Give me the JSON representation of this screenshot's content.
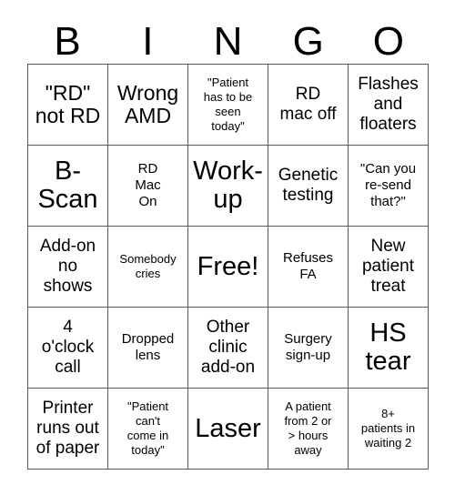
{
  "card": {
    "header_letters": [
      "B",
      "I",
      "N",
      "G",
      "O"
    ],
    "rows": [
      [
        {
          "text": "\"RD\"\nnot RD",
          "size": "lg"
        },
        {
          "text": "Wrong\nAMD",
          "size": "lg"
        },
        {
          "text": "\"Patient\nhas to be\nseen\ntoday\"",
          "size": "xs"
        },
        {
          "text": "RD\nmac off",
          "size": "md"
        },
        {
          "text": "Flashes\nand\nfloaters",
          "size": "md"
        }
      ],
      [
        {
          "text": "B-\nScan",
          "size": "xl"
        },
        {
          "text": "RD\nMac\nOn",
          "size": "sm"
        },
        {
          "text": "Work-\nup",
          "size": "xl"
        },
        {
          "text": "Genetic\ntesting",
          "size": "md"
        },
        {
          "text": "\"Can you\nre-send\nthat?\"",
          "size": "sm"
        }
      ],
      [
        {
          "text": "Add-on\nno\nshows",
          "size": "md"
        },
        {
          "text": "Somebody\ncries",
          "size": "xs"
        },
        {
          "text": "Free!",
          "size": "xl"
        },
        {
          "text": "Refuses\nFA",
          "size": "sm"
        },
        {
          "text": "New\npatient\ntreat",
          "size": "md"
        }
      ],
      [
        {
          "text": "4\no'clock\ncall",
          "size": "md"
        },
        {
          "text": "Dropped\nlens",
          "size": "sm"
        },
        {
          "text": "Other\nclinic\nadd-on",
          "size": "md"
        },
        {
          "text": "Surgery\nsign-up",
          "size": "sm"
        },
        {
          "text": "HS\ntear",
          "size": "xl"
        }
      ],
      [
        {
          "text": "Printer\nruns out\nof paper",
          "size": "md"
        },
        {
          "text": "\"Patient\ncan't\ncome in\ntoday\"",
          "size": "xs"
        },
        {
          "text": "Laser",
          "size": "xl"
        },
        {
          "text": "A patient\nfrom 2 or\n> hours\naway",
          "size": "xs"
        },
        {
          "text": "8+\npatients in\nwaiting 2",
          "size": "xs"
        }
      ]
    ]
  },
  "colors": {
    "grid_line": "#5a5a5a",
    "text": "#000000",
    "background": "#ffffff"
  }
}
